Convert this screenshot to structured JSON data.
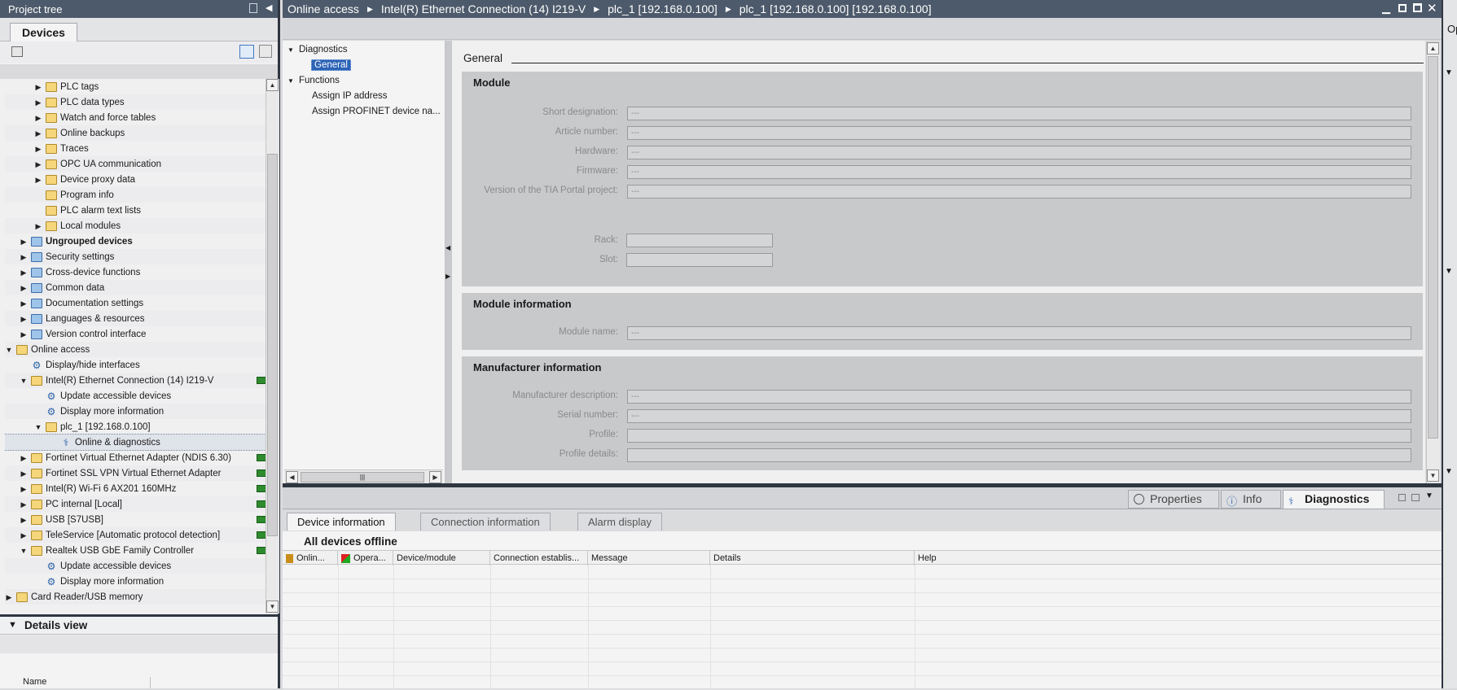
{
  "project_tree": {
    "title": "Project tree",
    "tab_devices": "Devices",
    "items": [
      {
        "label": "PLC tags",
        "level": 2,
        "expand": "right"
      },
      {
        "label": "PLC data types",
        "level": 2,
        "expand": "right"
      },
      {
        "label": "Watch and force tables",
        "level": 2,
        "expand": "right"
      },
      {
        "label": "Online backups",
        "level": 2,
        "expand": "right"
      },
      {
        "label": "Traces",
        "level": 2,
        "expand": "right"
      },
      {
        "label": "OPC UA communication",
        "level": 2,
        "expand": "right"
      },
      {
        "label": "Device proxy data",
        "level": 2,
        "expand": "right"
      },
      {
        "label": "Program info",
        "level": 2,
        "expand": "none"
      },
      {
        "label": "PLC alarm text lists",
        "level": 2,
        "expand": "none"
      },
      {
        "label": "Local modules",
        "level": 2,
        "expand": "right"
      },
      {
        "label": "Ungrouped devices",
        "level": 1,
        "expand": "right",
        "bold": true
      },
      {
        "label": "Security settings",
        "level": 1,
        "expand": "right"
      },
      {
        "label": "Cross-device functions",
        "level": 1,
        "expand": "right"
      },
      {
        "label": "Common data",
        "level": 1,
        "expand": "right"
      },
      {
        "label": "Documentation settings",
        "level": 1,
        "expand": "right"
      },
      {
        "label": "Languages & resources",
        "level": 1,
        "expand": "right"
      },
      {
        "label": "Version control interface",
        "level": 1,
        "expand": "right"
      },
      {
        "label": "Online access",
        "level": 0,
        "expand": "down"
      },
      {
        "label": "Display/hide interfaces",
        "level": 1,
        "expand": "none"
      },
      {
        "label": "Intel(R) Ethernet Connection (14) I219-V",
        "level": 1,
        "expand": "down"
      },
      {
        "label": "Update accessible devices",
        "level": 2,
        "expand": "none"
      },
      {
        "label": "Display more information",
        "level": 2,
        "expand": "none"
      },
      {
        "label": "plc_1 [192.168.0.100]",
        "level": 2,
        "expand": "down"
      },
      {
        "label": "Online & diagnostics",
        "level": 3,
        "expand": "none",
        "selected": true
      },
      {
        "label": "Fortinet Virtual Ethernet Adapter (NDIS 6.30)",
        "level": 1,
        "expand": "right"
      },
      {
        "label": "Fortinet SSL VPN Virtual Ethernet Adapter",
        "level": 1,
        "expand": "right"
      },
      {
        "label": "Intel(R) Wi-Fi 6 AX201 160MHz",
        "level": 1,
        "expand": "right"
      },
      {
        "label": "PC internal [Local]",
        "level": 1,
        "expand": "right"
      },
      {
        "label": "USB [S7USB]",
        "level": 1,
        "expand": "right"
      },
      {
        "label": "TeleService [Automatic protocol detection]",
        "level": 1,
        "expand": "right"
      },
      {
        "label": "Realtek USB GbE Family Controller",
        "level": 1,
        "expand": "down"
      },
      {
        "label": "Update accessible devices",
        "level": 2,
        "expand": "none"
      },
      {
        "label": "Display more information",
        "level": 2,
        "expand": "none"
      },
      {
        "label": "Card Reader/USB memory",
        "level": 0,
        "expand": "right"
      }
    ],
    "details_view": "Details view",
    "details_col_name": "Name"
  },
  "editor": {
    "breadcrumb": [
      "Online access",
      "Intel(R) Ethernet Connection (14) I219-V",
      "plc_1 [192.168.0.100]",
      "plc_1 [192.168.0.100] [192.168.0.100]"
    ],
    "nav": {
      "diagnostics": "Diagnostics",
      "general": "General",
      "functions": "Functions",
      "assign_ip": "Assign IP address",
      "assign_profinet": "Assign PROFINET device na..."
    },
    "section_title": "General",
    "module": {
      "title": "Module",
      "short_designation": {
        "label": "Short designation:",
        "value": "---"
      },
      "article_number": {
        "label": "Article number:",
        "value": "---"
      },
      "hardware": {
        "label": "Hardware:",
        "value": "---"
      },
      "firmware": {
        "label": "Firmware:",
        "value": "---"
      },
      "tia_version": {
        "label": "Version of the TIA Portal project:",
        "value": "---"
      },
      "rack": {
        "label": "Rack:",
        "value": ""
      },
      "slot": {
        "label": "Slot:",
        "value": ""
      }
    },
    "module_info": {
      "title": "Module information",
      "module_name": {
        "label": "Module name:",
        "value": "---"
      }
    },
    "manufacturer_info": {
      "title": "Manufacturer information",
      "description": {
        "label": "Manufacturer description:",
        "value": "---"
      },
      "serial": {
        "label": "Serial number:",
        "value": "---"
      },
      "profile": {
        "label": "Profile:",
        "value": ""
      },
      "profile_details": {
        "label": "Profile details:",
        "value": ""
      }
    }
  },
  "inspector": {
    "tab_properties": "Properties",
    "tab_info": "Info",
    "tab_diagnostics": "Diagnostics",
    "subtabs": [
      "Device information",
      "Connection information",
      "Alarm display"
    ],
    "status": "All devices offline",
    "columns": [
      "Onlin...",
      "Opera...",
      "Device/module",
      "Connection establis...",
      "Message",
      "Details",
      "Help"
    ]
  },
  "right_edge": {
    "label": "Op"
  },
  "colors": {
    "titlebar": "#4d5a6b",
    "selection": "#2b63b6",
    "network_green": "#2e8b2e"
  }
}
